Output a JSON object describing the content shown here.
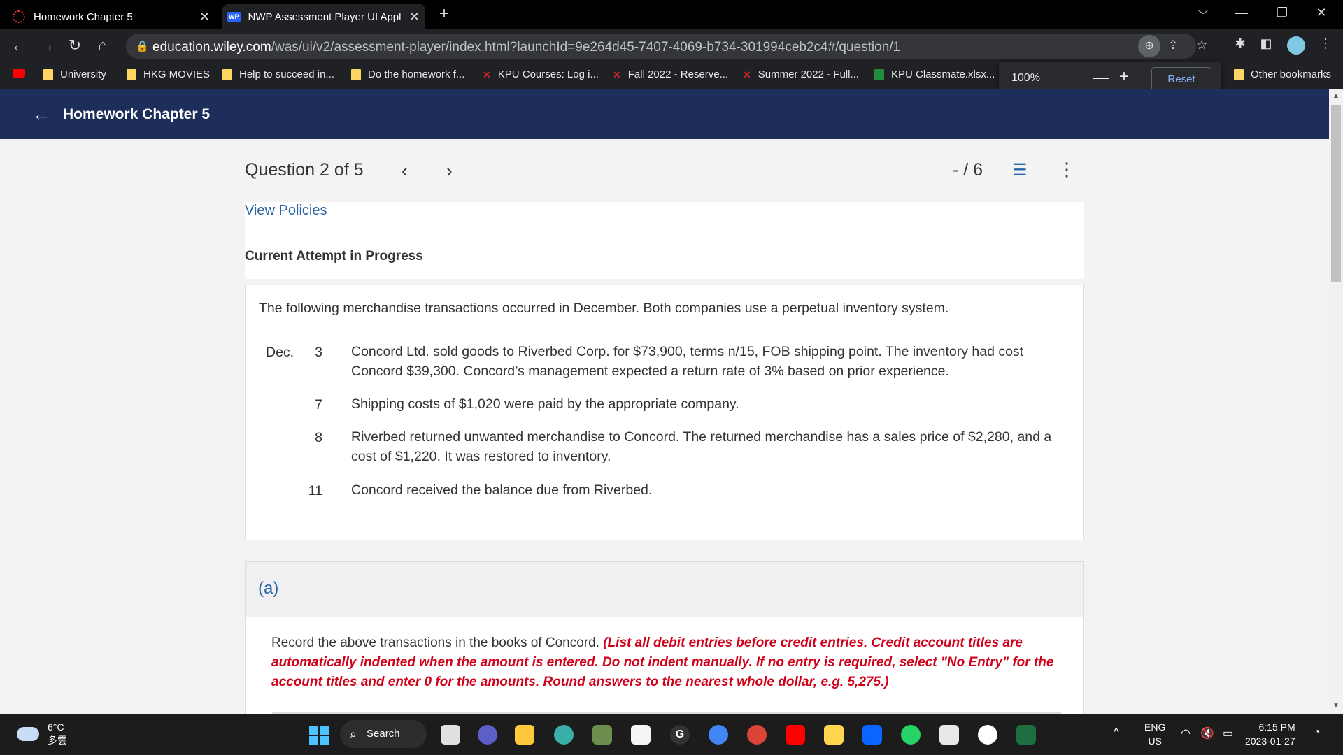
{
  "browser": {
    "tabs": [
      {
        "title": "Homework Chapter 5",
        "active": false
      },
      {
        "title": "NWP Assessment Player UI Appli",
        "active": true
      }
    ],
    "url_host": "education.wiley.com",
    "url_path": "/was/ui/v2/assessment-player/index.html?launchId=9e264d45-7407-4069-b734-301994ceb2c4#/question/1",
    "bookmarks": [
      "University",
      "HKG MOVIES",
      "Help to succeed in...",
      "Do the homework f...",
      "KPU Courses: Log i...",
      "Fall 2022 - Reserve...",
      "Summer 2022 - Full...",
      "KPU Classmate.xlsx..."
    ],
    "other_bookmarks": "Other bookmarks",
    "zoom": {
      "percent": "100%",
      "reset_label": "Reset"
    }
  },
  "app": {
    "header_title": "Homework Chapter 5",
    "question_label": "Question 2 of 5",
    "score": "- / 6",
    "view_policies": "View Policies",
    "attempt_status": "Current Attempt in Progress",
    "question": {
      "intro": "The following merchandise transactions occurred in December. Both companies use a perpetual inventory system.",
      "month": "Dec.",
      "transactions": [
        {
          "day": "3",
          "text": "Concord Ltd. sold goods to Riverbed Corp. for $73,900, terms n/15, FOB shipping point. The inventory had cost Concord $39,300. Concord’s management expected a return rate of 3% based on prior experience."
        },
        {
          "day": "7",
          "text": "Shipping costs of $1,020 were paid by the appropriate company."
        },
        {
          "day": "8",
          "text": "Riverbed returned unwanted merchandise to Concord. The returned merchandise has a sales price of $2,280, and a cost of $1,220. It was restored to inventory."
        },
        {
          "day": "11",
          "text": "Concord received the balance due from Riverbed."
        }
      ]
    },
    "part": {
      "label": "(a)",
      "instruction_plain": "Record the above transactions in the books of Concord. ",
      "instruction_red": "(List all debit entries before credit entries. Credit account titles are automatically indented when the amount is entered. Do not indent manually. If no entry is required, select \"No Entry\" for the account titles and enter 0 for the amounts. Round answers to the nearest whole dollar, e.g. 5,275.)"
    }
  },
  "taskbar": {
    "weather_temp": "6°C",
    "weather_desc": "多雲",
    "search_label": "Search",
    "lang_top": "ENG",
    "lang_bottom": "US",
    "time": "6:15 PM",
    "date": "2023-01-27"
  },
  "colors": {
    "header_bg": "#1d2e5a",
    "link": "#2a64a8",
    "instruction_red": "#d0021b"
  }
}
